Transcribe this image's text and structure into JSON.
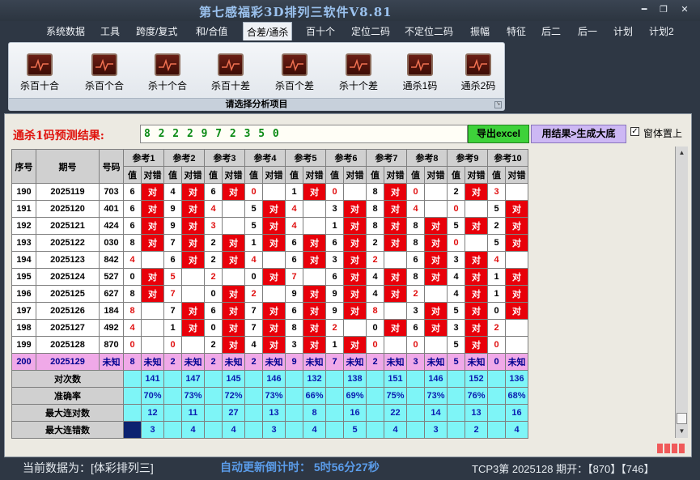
{
  "window": {
    "title": "第七感福彩3D排列三软件V8.81",
    "minimize": "━",
    "restore": "❐",
    "close": "✕"
  },
  "menu": [
    "系统数据",
    "工具",
    "跨度/复式",
    "和/合值",
    "合差/通杀",
    "百十个",
    "定位二码",
    "不定位二码",
    "振幅",
    "特征",
    "后二",
    "后一",
    "计划",
    "计划2"
  ],
  "menu_active": "合差/通杀",
  "ribbon": {
    "buttons": [
      "杀百十合",
      "杀百个合",
      "杀十个合",
      "杀百十差",
      "杀百个差",
      "杀十个差",
      "通杀1码",
      "通杀2码"
    ],
    "caption": "请选择分析项目"
  },
  "prediction": {
    "label": "通杀1码预测结果:",
    "value": "8 2 2 2 9 7 2 3 5 0",
    "btn_excel": "导出excel",
    "btn_generate": "用结果>生成大底",
    "topmost_label": "窗体置上",
    "topmost_checked": "✓"
  },
  "table": {
    "headers": [
      "序号",
      "期号",
      "号码"
    ],
    "ref_headers": [
      "参考1",
      "参考2",
      "参考3",
      "参考4",
      "参考5",
      "参考6",
      "参考7",
      "参考8",
      "参考9",
      "参考10"
    ],
    "sub_headers": [
      "值",
      "对错"
    ],
    "ok_mark": "对",
    "rows": [
      {
        "seq": "190",
        "issue": "2025119",
        "num": "703",
        "vals": [
          "6",
          "4",
          "6",
          "0",
          "1",
          "0",
          "8",
          "0",
          "2",
          "3"
        ],
        "ok": [
          1,
          1,
          1,
          0,
          1,
          0,
          1,
          0,
          1,
          0
        ]
      },
      {
        "seq": "191",
        "issue": "2025120",
        "num": "401",
        "vals": [
          "6",
          "9",
          "4",
          "5",
          "4",
          "3",
          "8",
          "4",
          "0",
          "5"
        ],
        "ok": [
          1,
          1,
          0,
          1,
          0,
          1,
          1,
          0,
          0,
          1
        ]
      },
      {
        "seq": "192",
        "issue": "2025121",
        "num": "424",
        "vals": [
          "6",
          "9",
          "3",
          "5",
          "4",
          "1",
          "8",
          "8",
          "5",
          "2"
        ],
        "ok": [
          1,
          1,
          0,
          1,
          0,
          1,
          1,
          1,
          1,
          1
        ]
      },
      {
        "seq": "193",
        "issue": "2025122",
        "num": "030",
        "vals": [
          "8",
          "7",
          "2",
          "1",
          "6",
          "6",
          "2",
          "8",
          "0",
          "5"
        ],
        "ok": [
          1,
          1,
          1,
          1,
          1,
          1,
          1,
          1,
          0,
          1
        ]
      },
      {
        "seq": "194",
        "issue": "2025123",
        "num": "842",
        "vals": [
          "4",
          "6",
          "2",
          "4",
          "6",
          "3",
          "2",
          "6",
          "3",
          "4"
        ],
        "ok": [
          0,
          1,
          1,
          0,
          1,
          1,
          0,
          1,
          1,
          0
        ]
      },
      {
        "seq": "195",
        "issue": "2025124",
        "num": "527",
        "vals": [
          "0",
          "5",
          "2",
          "0",
          "7",
          "6",
          "4",
          "8",
          "4",
          "1"
        ],
        "ok": [
          1,
          0,
          0,
          1,
          0,
          1,
          1,
          1,
          1,
          1
        ]
      },
      {
        "seq": "196",
        "issue": "2025125",
        "num": "627",
        "vals": [
          "8",
          "7",
          "0",
          "2",
          "9",
          "9",
          "4",
          "2",
          "4",
          "1"
        ],
        "ok": [
          1,
          0,
          1,
          0,
          1,
          1,
          1,
          0,
          1,
          1
        ]
      },
      {
        "seq": "197",
        "issue": "2025126",
        "num": "184",
        "vals": [
          "8",
          "7",
          "6",
          "7",
          "6",
          "9",
          "8",
          "3",
          "5",
          "0"
        ],
        "ok": [
          0,
          1,
          1,
          1,
          1,
          1,
          0,
          1,
          1,
          1
        ]
      },
      {
        "seq": "198",
        "issue": "2025127",
        "num": "492",
        "vals": [
          "4",
          "1",
          "0",
          "7",
          "8",
          "2",
          "0",
          "6",
          "3",
          "2"
        ],
        "ok": [
          0,
          1,
          1,
          1,
          1,
          0,
          1,
          1,
          1,
          0
        ]
      },
      {
        "seq": "199",
        "issue": "2025128",
        "num": "870",
        "vals": [
          "0",
          "0",
          "2",
          "4",
          "3",
          "1",
          "0",
          "0",
          "5",
          "0"
        ],
        "ok": [
          0,
          0,
          1,
          1,
          1,
          1,
          0,
          0,
          1,
          0
        ]
      },
      {
        "seq": "200",
        "issue": "2025129",
        "num": "未知",
        "vals": [
          "8",
          "2",
          "2",
          "2",
          "9",
          "7",
          "2",
          "3",
          "5",
          "0"
        ],
        "pred": "未知"
      }
    ],
    "stats": [
      {
        "label": "对次数",
        "values": [
          "141",
          "147",
          "145",
          "146",
          "132",
          "138",
          "151",
          "146",
          "152",
          "136"
        ]
      },
      {
        "label": "准确率",
        "values": [
          "70%",
          "73%",
          "72%",
          "73%",
          "66%",
          "69%",
          "75%",
          "73%",
          "76%",
          "68%"
        ]
      },
      {
        "label": "最大连对数",
        "values": [
          "12",
          "11",
          "27",
          "13",
          "8",
          "16",
          "22",
          "14",
          "13",
          "16"
        ]
      },
      {
        "label": "最大连错数",
        "values": [
          "3",
          "4",
          "4",
          "3",
          "4",
          "5",
          "4",
          "3",
          "2",
          "4"
        ]
      }
    ]
  },
  "status": {
    "current": "当前数据为：[体彩排列三]",
    "countdown": "自动更新倒计时：  5时56分27秒",
    "draw": "TCP3第  2025128 期开：【870】【746】"
  },
  "colors": {
    "ok": "#e8000a",
    "pred": "#f0a9e8",
    "stat": "#7ef5f7",
    "title": "#9bc2ee"
  }
}
